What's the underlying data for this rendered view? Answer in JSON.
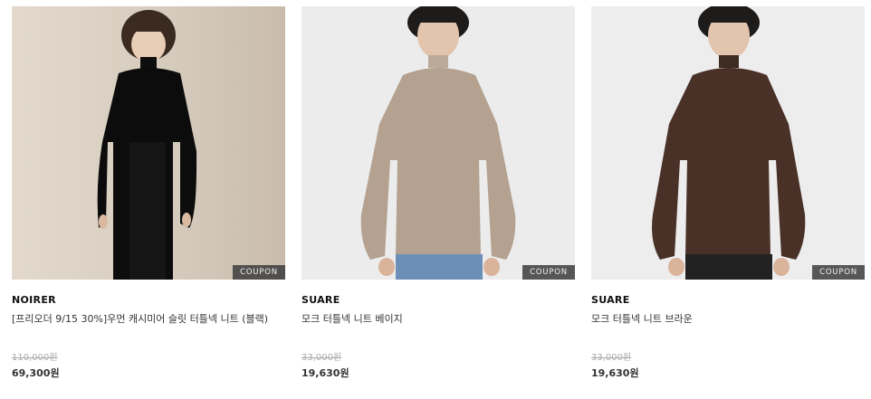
{
  "products": [
    {
      "brand": "NOIRER",
      "name": "[프리오더 9/15 30%]우먼 캐시미어 슬릿 터틀넥 니트 (블랙)",
      "original_price": "110,000원",
      "sale_price": "69,300원",
      "badge": "COUPON",
      "image": "woman-black-turtleneck-knit-photo"
    },
    {
      "brand": "SUARE",
      "name": "모크 터틀넥 니트 베이지",
      "original_price": "33,000원",
      "sale_price": "19,630원",
      "badge": "COUPON",
      "image": "man-beige-mock-neck-knit-photo"
    },
    {
      "brand": "SUARE",
      "name": "모크 터틀넥 니트 브라운",
      "original_price": "33,000원",
      "sale_price": "19,630원",
      "badge": "COUPON",
      "image": "man-brown-mock-neck-knit-photo"
    }
  ],
  "colors": {
    "badge_bg": "#3c3c3c",
    "strike_price": "#aaaaaa",
    "sale_price": "#333333"
  }
}
